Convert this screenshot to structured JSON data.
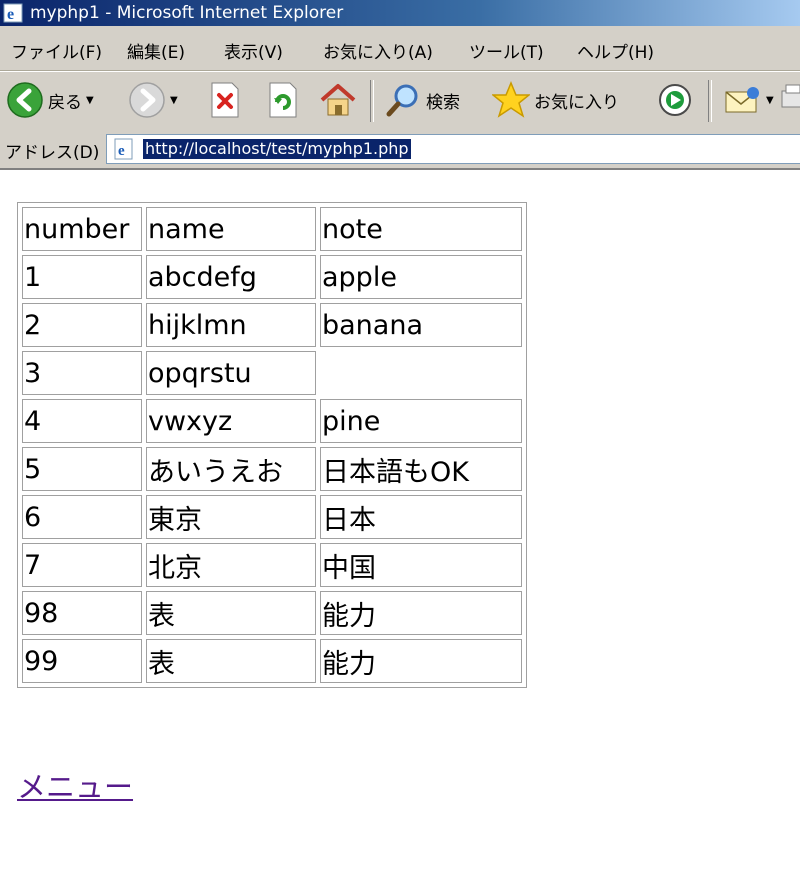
{
  "window": {
    "title": "myphp1 - Microsoft Internet Explorer"
  },
  "menu": [
    "ファイル(F)",
    "編集(E)",
    "表示(V)",
    "お気に入り(A)",
    "ツール(T)",
    "ヘルプ(H)"
  ],
  "toolbar": {
    "back_label": "戻る",
    "search_label": "検索",
    "favorites_label": "お気に入り"
  },
  "address": {
    "label": "アドレス(D)",
    "url": "http://localhost/test/myphp1.php"
  },
  "table": {
    "headers": [
      "number",
      "name",
      "note"
    ],
    "rows": [
      [
        "1",
        "abcdefg",
        "apple"
      ],
      [
        "2",
        "hijklmn",
        "banana"
      ],
      [
        "3",
        "opqrstu",
        ""
      ],
      [
        "4",
        "vwxyz",
        "pine"
      ],
      [
        "5",
        "あいうえお",
        "日本語もOK"
      ],
      [
        "6",
        "東京",
        "日本"
      ],
      [
        "7",
        "北京",
        "中国"
      ],
      [
        "98",
        "表",
        "能力"
      ],
      [
        "99",
        "表",
        "能力"
      ]
    ]
  },
  "link": {
    "menu_label": "メニュー"
  }
}
